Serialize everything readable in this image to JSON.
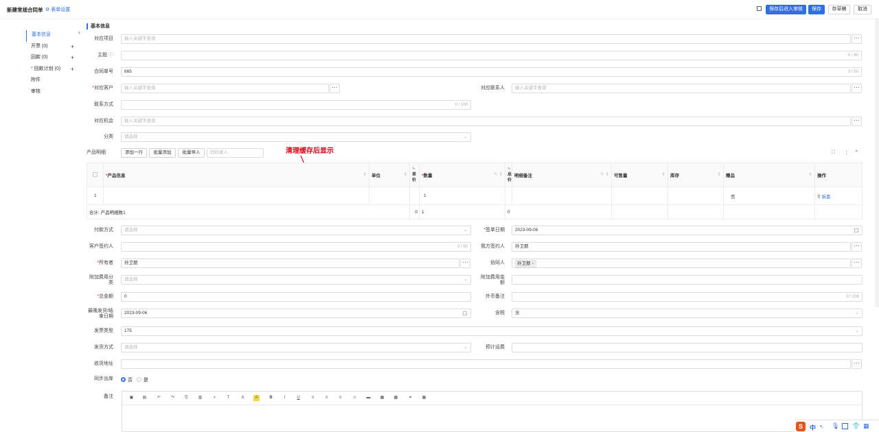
{
  "header": {
    "title": "新建常规合同单",
    "form_settings": "表单设置",
    "buttons": {
      "save_submit": "保存后进入审核",
      "save": "保存",
      "draft": "存草稿",
      "cancel": "取消"
    }
  },
  "sidebar": {
    "items": [
      {
        "label": "基本信息"
      },
      {
        "label": "开票",
        "count": "(0)"
      },
      {
        "label": "回款",
        "count": "(0)"
      },
      {
        "label": "回款计划",
        "count": "(0)"
      },
      {
        "label": "附件"
      },
      {
        "label": "审核"
      }
    ]
  },
  "section_title": "基本信息",
  "fields": {
    "project": {
      "label": "对应项目",
      "placeholder": "输入关键字查询"
    },
    "subject": {
      "label": "主题",
      "counter": "0 / 80"
    },
    "contract_no": {
      "label": "合同单号",
      "value": "665",
      "counter": "3 / 50"
    },
    "customer": {
      "label": "对应客户",
      "placeholder": "输入关键字查询"
    },
    "contact": {
      "label": "对应联系人",
      "placeholder": "输入关键字查询"
    },
    "phone": {
      "label": "联系方式",
      "counter": "0 / 100"
    },
    "opportunity": {
      "label": "对应机会",
      "placeholder": "输入关键字查询"
    },
    "category": {
      "label": "分类",
      "placeholder": "请选择"
    },
    "payment": {
      "label": "付款方式",
      "placeholder": "请选择"
    },
    "sign_date": {
      "label": "签单日期",
      "value": "2023-09-06"
    },
    "cust_signer": {
      "label": "客户签约人",
      "counter": "0 / 50"
    },
    "our_signer": {
      "label": "我方签约人",
      "value": "孙卫朋"
    },
    "owner": {
      "label": "所有者",
      "value": "孙卫朋"
    },
    "collaborator": {
      "label": "协同人",
      "value": "孙卫朋"
    },
    "extra_cat": {
      "label1": "附加费用分",
      "label2": "类",
      "placeholder": "请选择"
    },
    "extra_amt": {
      "label1": "附加费用金",
      "label2": "额"
    },
    "total": {
      "label": "总金额",
      "value": "0"
    },
    "fx_note": {
      "label": "外币备注",
      "counter": "0 / 200"
    },
    "last_ship": {
      "label1": "最晚发货/结",
      "label2": "束日期",
      "value": "2023-09-06"
    },
    "tax": {
      "label": "含税",
      "value": "含"
    },
    "invoice_type": {
      "label": "发票类型",
      "value": "175"
    },
    "ship_method": {
      "label": "发货方式",
      "placeholder": "请选择"
    },
    "est_margin": {
      "label": "预计运费"
    },
    "address": {
      "label": "收货地址"
    },
    "sync_out": {
      "label": "同步出库",
      "opt_no": "否",
      "opt_yes": "是"
    },
    "remark": {
      "label": "备注"
    }
  },
  "products": {
    "label": "产品明细",
    "buttons": {
      "add_row": "添加一行",
      "batch_add": "批量添加",
      "batch_import": "批量导入"
    },
    "scan_placeholder": "扫码录入",
    "columns": {
      "info": "产品信息",
      "unit": "单位",
      "price1": "单",
      "price2": "价",
      "qty": "数量",
      "total1": "总",
      "total2": "价",
      "note": "明细备注",
      "sellable": "可售量",
      "stock": "库存",
      "gift": "赠品",
      "ops": "操作"
    },
    "row": {
      "index": "1",
      "qty": "1",
      "gift": "否",
      "action": "拆套"
    },
    "summary": {
      "label": "合计: 产品明细数1",
      "price": "0",
      "qty": "1",
      "total": "0"
    }
  },
  "annotation": "清理缓存后显示",
  "ime": {
    "lang": "中"
  }
}
